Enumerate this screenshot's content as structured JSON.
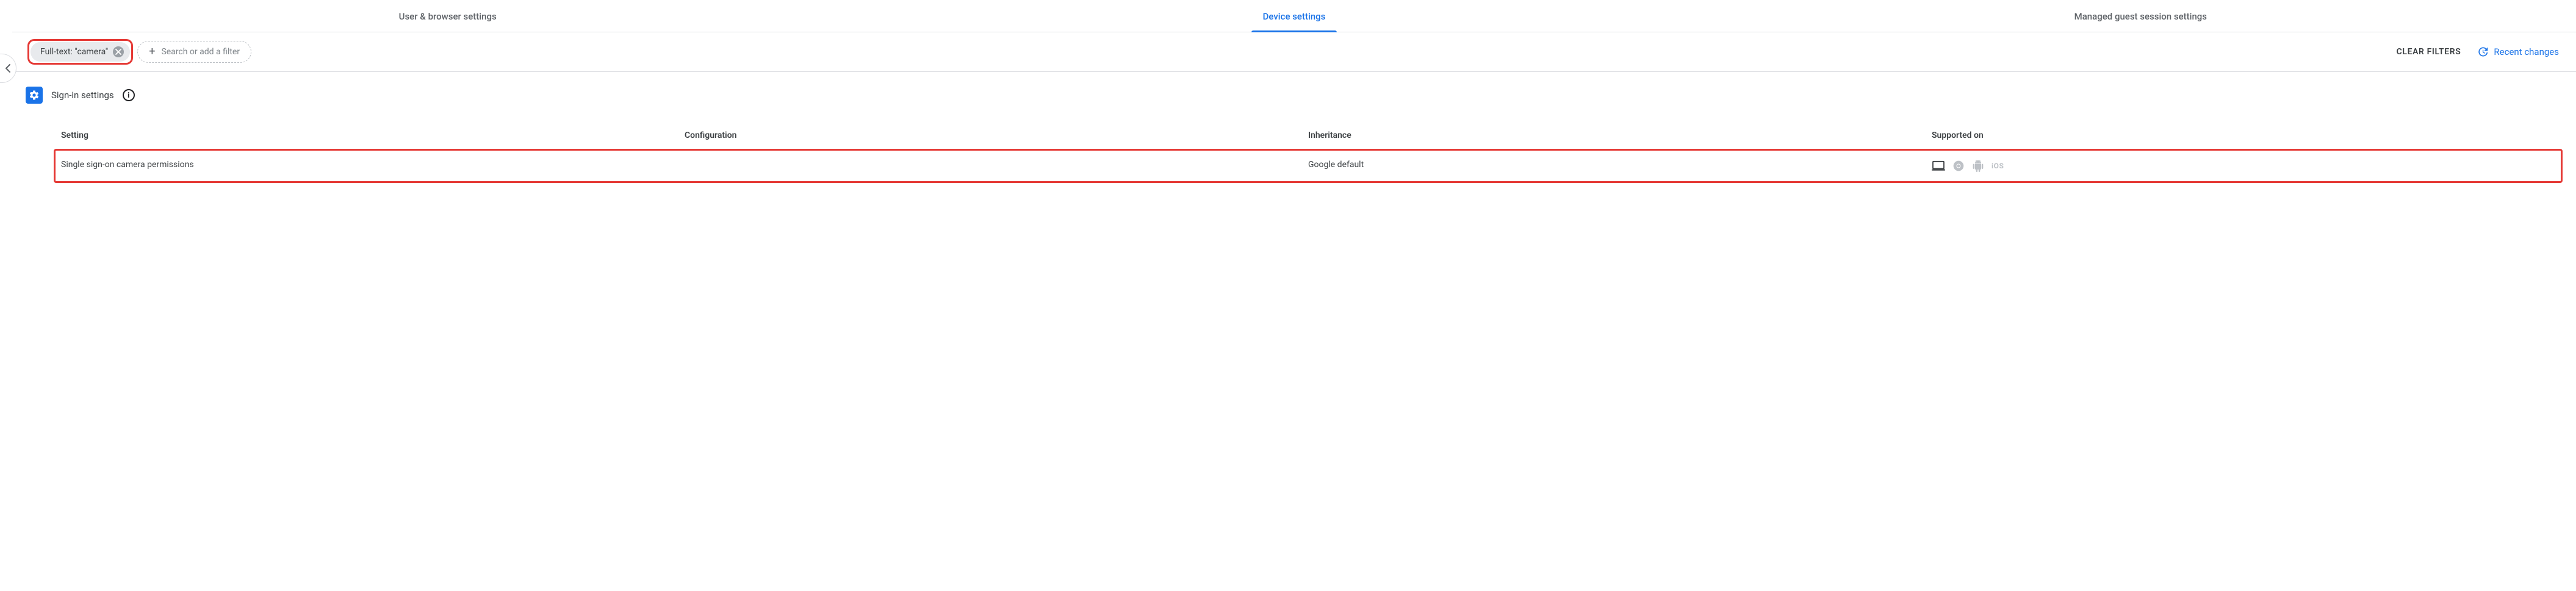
{
  "tabs": {
    "user_browser": "User & browser settings",
    "device": "Device settings",
    "managed_guest": "Managed guest session settings"
  },
  "filter_bar": {
    "chip_label": "Full-text: \"camera\"",
    "search_placeholder": "Search or add a filter",
    "clear_filters": "CLEAR FILTERS",
    "recent_changes": "Recent changes"
  },
  "section": {
    "title": "Sign-in settings"
  },
  "table": {
    "headers": {
      "setting": "Setting",
      "configuration": "Configuration",
      "inheritance": "Inheritance",
      "supported_on": "Supported on"
    },
    "rows": [
      {
        "setting": "Single sign-on camera permissions",
        "configuration": "",
        "inheritance": "Google default",
        "supported": {
          "chromeos": true,
          "chrome": false,
          "android": false,
          "ios": false
        }
      }
    ]
  },
  "icons": {
    "ios_label": "iOS"
  }
}
